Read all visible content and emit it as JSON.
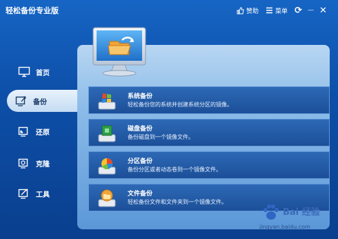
{
  "app": {
    "title": "轻松备份专业版"
  },
  "titlebar": {
    "sponsor_label": "赞助",
    "menu_label": "菜单",
    "refresh_glyph": "⟳",
    "minimize_glyph": "—",
    "close_glyph": "✕"
  },
  "sidebar": {
    "items": [
      {
        "label": "首页",
        "icon": "monitor-home-icon",
        "active": false
      },
      {
        "label": "备份",
        "icon": "backup-icon",
        "active": true
      },
      {
        "label": "还原",
        "icon": "restore-icon",
        "active": false
      },
      {
        "label": "克隆",
        "icon": "clone-icon",
        "active": false
      },
      {
        "label": "工具",
        "icon": "tools-icon",
        "active": false
      }
    ]
  },
  "backup_options": [
    {
      "title": "系统备份",
      "desc": "轻松备份您的系统并创建系统分区的镜像。",
      "icon": "windows-disk-icon"
    },
    {
      "title": "磁盘备份",
      "desc": "备份磁盘到一个镜像文件。",
      "icon": "green-disk-icon"
    },
    {
      "title": "分区备份",
      "desc": "备份分区或者动态卷到一个镜像文件。",
      "icon": "pie-disk-icon"
    },
    {
      "title": "文件备份",
      "desc": "轻松备份文件和文件夹到一个镜像文件。",
      "icon": "folder-disk-icon"
    }
  ],
  "watermark": {
    "brand": "Bai 经验",
    "url": "jingyan.baidu.com"
  },
  "colors": {
    "background": "#1665c4",
    "panel": "#b8d6f2",
    "item": "#2d69b6",
    "accent_orange": "#f2a53a"
  }
}
